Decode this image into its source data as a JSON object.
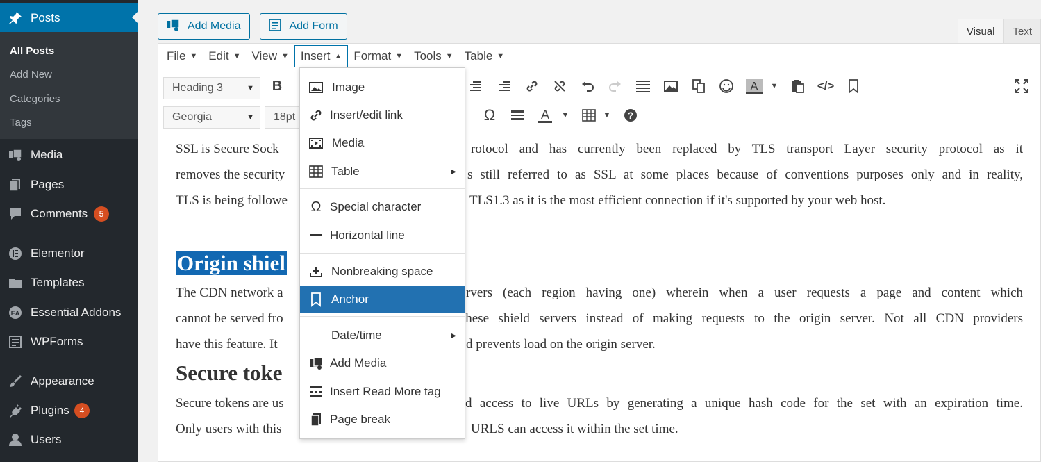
{
  "sidebar": {
    "posts": "Posts",
    "submenu": [
      "All Posts",
      "Add New",
      "Categories",
      "Tags"
    ],
    "media": "Media",
    "pages": "Pages",
    "comments": "Comments",
    "comments_badge": "5",
    "elementor": "Elementor",
    "templates": "Templates",
    "essential_addons": "Essential Addons",
    "wpforms": "WPForms",
    "appearance": "Appearance",
    "plugins": "Plugins",
    "plugins_badge": "4",
    "users": "Users"
  },
  "buttons": {
    "add_media": "Add Media",
    "add_form": "Add Form"
  },
  "tabs": {
    "visual": "Visual",
    "text": "Text"
  },
  "menubar": [
    "File",
    "Edit",
    "View",
    "Insert",
    "Format",
    "Tools",
    "Table"
  ],
  "toolbar": {
    "block_format": "Heading 3",
    "font_family": "Georgia",
    "font_size": "18pt"
  },
  "dropdown": {
    "items": [
      "Image",
      "Insert/edit link",
      "Media",
      "Table",
      "Special character",
      "Horizontal line",
      "Nonbreaking space",
      "Anchor",
      "Date/time",
      "Add Media",
      "Insert Read More tag",
      "Page break"
    ]
  },
  "content": {
    "p1_line1": "SSL is Secure Sock",
    "p1_line1b": "rotocol and has currently been replaced by TLS transport Layer security protocol as it",
    "p1_line2": "removes the security",
    "p1_line2b": "s still referred to as SSL at some places because of conventions purposes only and in reality,",
    "p1_line3": "TLS is being followe",
    "p1_line3b": "TLS1.3 as it is the most efficient connection if it's supported by your web host.",
    "h_origin": "Origin shiel",
    "p2_line1": "The CDN network a",
    "p2_line1b": "rvers (each region having one) wherein when a user requests a page and content which",
    "p2_line2": "cannot be served fro",
    "p2_line2b": "these shield servers instead of making requests to the origin server. Not all CDN providers",
    "p2_line3": "have this feature. It",
    "p2_line3b": "d prevents load on the origin server.",
    "h_secure": "Secure toke",
    "p3_line1": "Secure tokens are us",
    "p3_line1b": "d access to live URLs by generating a unique hash code for the set with an expiration time.",
    "p3_line2": "Only users with this",
    "p3_line2b": "URLS can access it within the set time."
  }
}
